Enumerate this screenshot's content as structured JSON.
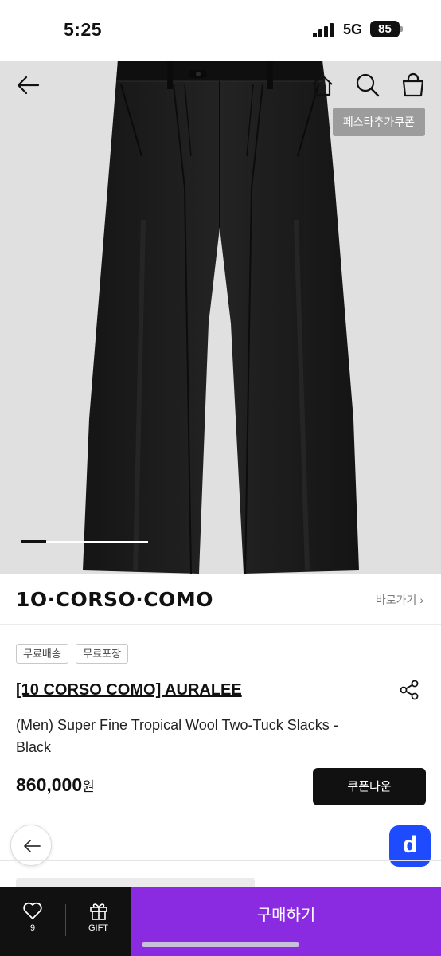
{
  "status_bar": {
    "time": "5:25",
    "network": "5G",
    "battery": "85"
  },
  "header": {
    "coupon_tag": "페스타추가쿠폰"
  },
  "gallery": {
    "progress": 0.2
  },
  "brand": {
    "logo": "1O·CORSO·COMO",
    "link_label": "바로가기 ›"
  },
  "tags": [
    "무료배송",
    "무료포장"
  ],
  "product": {
    "brand": "[10 CORSO COMO] AURALEE",
    "name": "(Men) Super Fine Tropical Wool Two-Tuck Slacks - Black",
    "price": "860,000",
    "currency": "원",
    "coupon_button": "쿠폰다운"
  },
  "fab": {
    "d_label": "d"
  },
  "bottom_bar": {
    "wish_count": "9",
    "gift_label": "GIFT",
    "buy_label": "구매하기"
  },
  "colors": {
    "accent": "#8a2be2",
    "dark": "#111111",
    "fab": "#1f4bff"
  }
}
